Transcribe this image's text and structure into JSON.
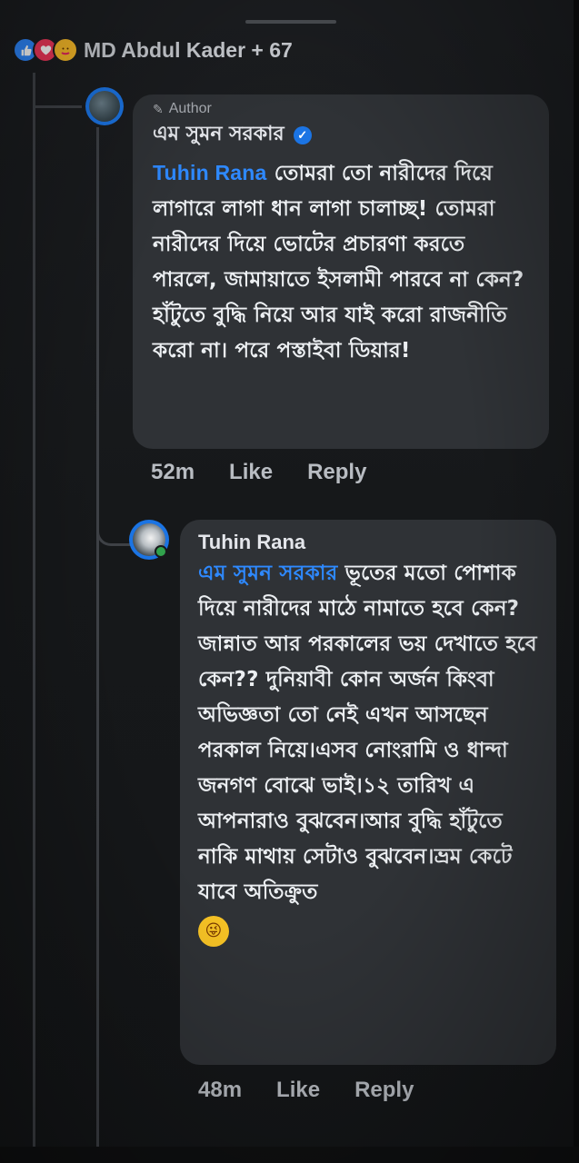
{
  "reactions": {
    "types": [
      "like-icon",
      "love-icon",
      "care-icon"
    ],
    "summary": "MD Abdul Kader + 67"
  },
  "author_comment": {
    "badge": "Author",
    "name": "এম সুমন সরকার",
    "verified": true,
    "mention": "Tuhin Rana",
    "text": "তোমরা তো নারীদের দিয়ে লাগারে লাগা ধান লাগা চালাচ্ছ! তোমরা নারীদের দিয়ে ভোটের প্রচারণা করতে পারলে, জামায়াতে ইসলামী পারবে না কেন? হাঁটুতে বুদ্ধি নিয়ে আর যাই করো রাজনীতি করো না। পরে পস্তাইবা ডিয়ার!",
    "time": "52m",
    "like_label": "Like",
    "reply_label": "Reply"
  },
  "reply_comment": {
    "name": "Tuhin Rana",
    "mention": "এম সুমন সরকার",
    "text": "ভূতের মতো পোশাক দিয়ে নারীদের মাঠে নামাতে হবে কেন? জান্নাত আর পরকালের ভয় দেখাতে হবে কেন?? দুনিয়াবী কোন অর্জন কিংবা অভিজ্ঞতা তো নেই এখন আসছেন পরকাল নিয়ে।এসব নোংরামি ও ধান্দা জনগণ বোঝে ভাই।১২ তারিখ এ আপনারাও বুঝবেন।আর বুদ্ধি হাঁটুতে নাকি মাথায় সেটাও বুঝবেন।ভ্রম কেটে যাবে অতিক্রুত",
    "emoji": "😜",
    "time": "48m",
    "like_label": "Like",
    "reply_label": "Reply"
  },
  "colors": {
    "background": "#17191b",
    "bubble": "#2f3236",
    "mention": "#2e89ff",
    "meta": "#b8bcc2",
    "thread_line": "#3e4146"
  }
}
